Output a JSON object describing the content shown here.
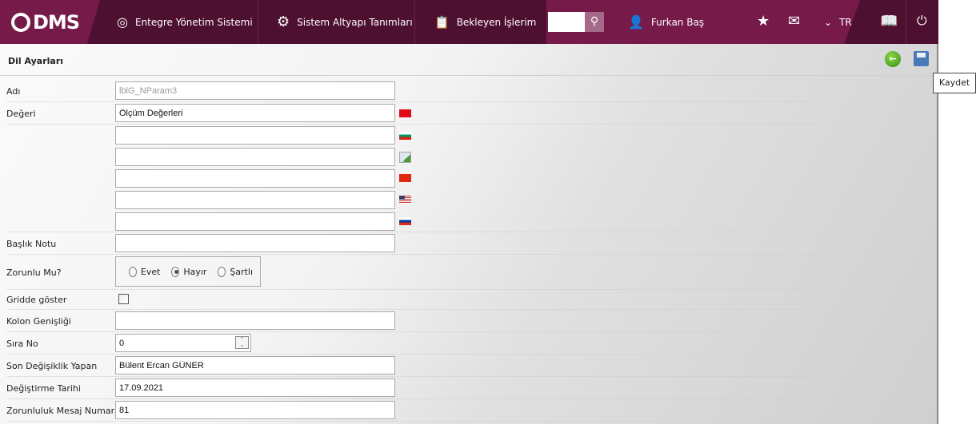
{
  "header": {
    "logo": "DMS",
    "nav": [
      "Entegre Yönetim Sistemi",
      "Sistem Altyapı Tanımları",
      "Bekleyen İşlerim"
    ],
    "search_value": "",
    "user": "Furkan Baş",
    "language": "TR"
  },
  "page": {
    "title": "Dil Ayarları",
    "tooltip": "Kaydet"
  },
  "form": {
    "adi_label": "Adı",
    "adi_value": "lblG_NParam3",
    "degeri_label": "Değeri",
    "degeri_tr": "Ölçüm Değerleri",
    "degeri_bg": "",
    "degeri_unknown": "",
    "degeri_cn": "",
    "degeri_us": "",
    "degeri_ru": "",
    "baslik_label": "Başlık Notu",
    "baslik_value": "",
    "zorunlu_label": "Zorunlu Mu?",
    "options": [
      "Evet",
      "Hayır",
      "Şartlı"
    ],
    "selected": "Hayır",
    "gridde_label": "Gridde göster",
    "gridde_checked": false,
    "kolon_label": "Kolon Genişliği",
    "kolon_value": "",
    "sira_label": "Sıra No",
    "sira_value": "0",
    "son_label": "Son Değişiklik Yapan",
    "son_value": "Bülent Ercan GÜNER",
    "tarih_label": "Değiştirme Tarihi",
    "tarih_value": "17.09.2021",
    "mesaj_label": "Zorunluluk Mesaj Numarası",
    "mesaj_value": "81"
  },
  "colors": {
    "header_dark": "#4e1030",
    "header_accent": "#761a4a"
  }
}
